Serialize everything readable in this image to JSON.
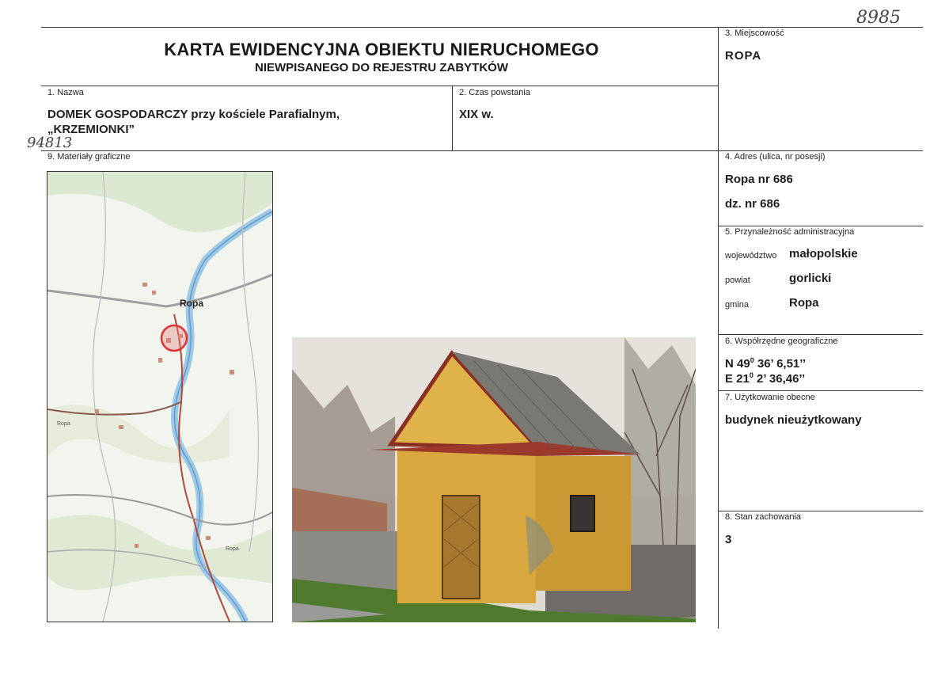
{
  "handwritten": {
    "top_number": "8985",
    "side_number": "94813"
  },
  "header": {
    "title_line1": "KARTA EWIDENCYJNA OBIEKTU NIERUCHOMEGO",
    "title_line2": "NIEWPISANEGO DO REJESTRU ZABYTKÓW"
  },
  "fields": {
    "miejscowosc": {
      "label": "3. Miejscowość",
      "value": "ROPA"
    },
    "nazwa": {
      "label": "1. Nazwa",
      "value_line1": "DOMEK GOSPODARCZY przy kościele Parafialnym,",
      "value_line2": "„KRZEMIONKI”"
    },
    "czas": {
      "label": "2. Czas powstania",
      "value": "XIX w."
    },
    "materialy": {
      "label": "9. Materiały graficzne"
    },
    "adres": {
      "label": "4. Adres (ulica, nr posesji)",
      "line1": "Ropa nr 686",
      "line2": "dz. nr 686"
    },
    "przynaleznosc": {
      "label": "5. Przynależność administracyjna",
      "rows": [
        {
          "key": "województwo",
          "value": "małopolskie"
        },
        {
          "key": "powiat",
          "value": "gorlicki"
        },
        {
          "key": "gmina",
          "value": "Ropa"
        }
      ]
    },
    "wspolrzedne": {
      "label": "6. Współrzędne geograficzne",
      "n": "N 49",
      "n_rest": " 36’ 6,51’’",
      "e": "E 21",
      "e_rest": " 2’ 36,46’’",
      "deg": "0"
    },
    "uzytkowanie": {
      "label": "7. Użytkowanie obecne",
      "value": "budynek nieużytkowany"
    },
    "stan": {
      "label": "8. Stan zachowania",
      "value": "3"
    }
  },
  "map": {
    "place_label": "Ropa",
    "labels": [
      "Ropa",
      "Ropa",
      "Ropa"
    ]
  }
}
